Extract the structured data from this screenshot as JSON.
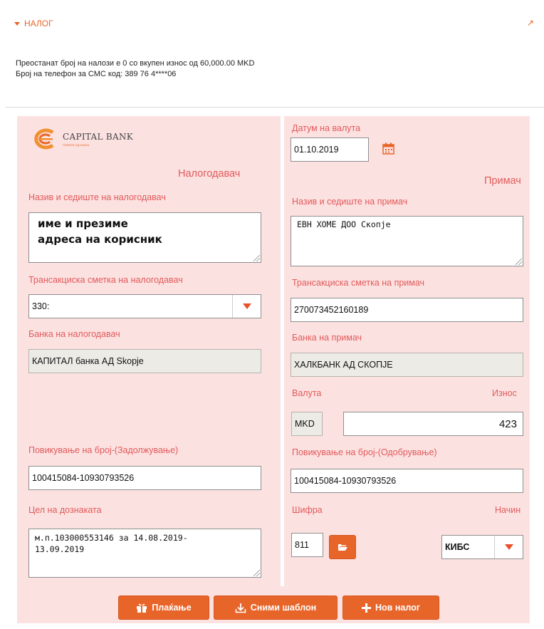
{
  "header": {
    "title": "НАЛОГ"
  },
  "info": {
    "line1": "Преостанат број на налози е 0 со вкупен износ од 60,000.00 MKD",
    "line2": "Број на телефон за СМС код: 389 76 4****06"
  },
  "bank": {
    "name": "CAPITAL BANK",
    "tagline": "ПОВЕЌЕ ОД БАНКА"
  },
  "sender": {
    "section_title": "Налогодавач",
    "name_label": "Назив и седиште на налогодавач",
    "name_value": "име и презиме\nадреса на корисник",
    "account_label": "Трансакциска сметка на налогодавач",
    "account_value": "330:",
    "bank_label": "Банка на налогодавач",
    "bank_value": "КАПИТАЛ банка АД Skopje",
    "ref_label": "Повикување на број-(Задолжување)",
    "ref_value": "100415084-10930793526",
    "purpose_label": "Цел на дознаката",
    "purpose_value": "м.п.103000553146 за 14.08.2019-\n13.09.2019"
  },
  "receiver": {
    "date_label": "Датум на валута",
    "date_value": "01.10.2019",
    "section_title": "Примач",
    "name_label": "Назив и седиште на примач",
    "name_value": "ЕВН ХОМЕ ДОО Скопје",
    "account_label": "Трансакциска сметка на примач",
    "account_value": "270073452160189",
    "bank_label": "Банка на примач",
    "bank_value": "ХАЛКБАНК АД СКОПЈЕ",
    "currency_label": "Валута",
    "amount_label": "Износ",
    "currency_value": "MKD",
    "amount_value": "423",
    "ref_label": "Повикување на број-(Одобрување)",
    "ref_value": "100415084-10930793526",
    "code_label": "Шифра",
    "method_label": "Начин",
    "code_value": "811",
    "method_value": "КИБС"
  },
  "actions": {
    "pay": "Плаќање",
    "save_template": "Сними шаблон",
    "new_order": "Нов налог"
  },
  "colors": {
    "accent": "#e8652a",
    "panel": "#fce1e1",
    "label": "#e25a5a"
  }
}
